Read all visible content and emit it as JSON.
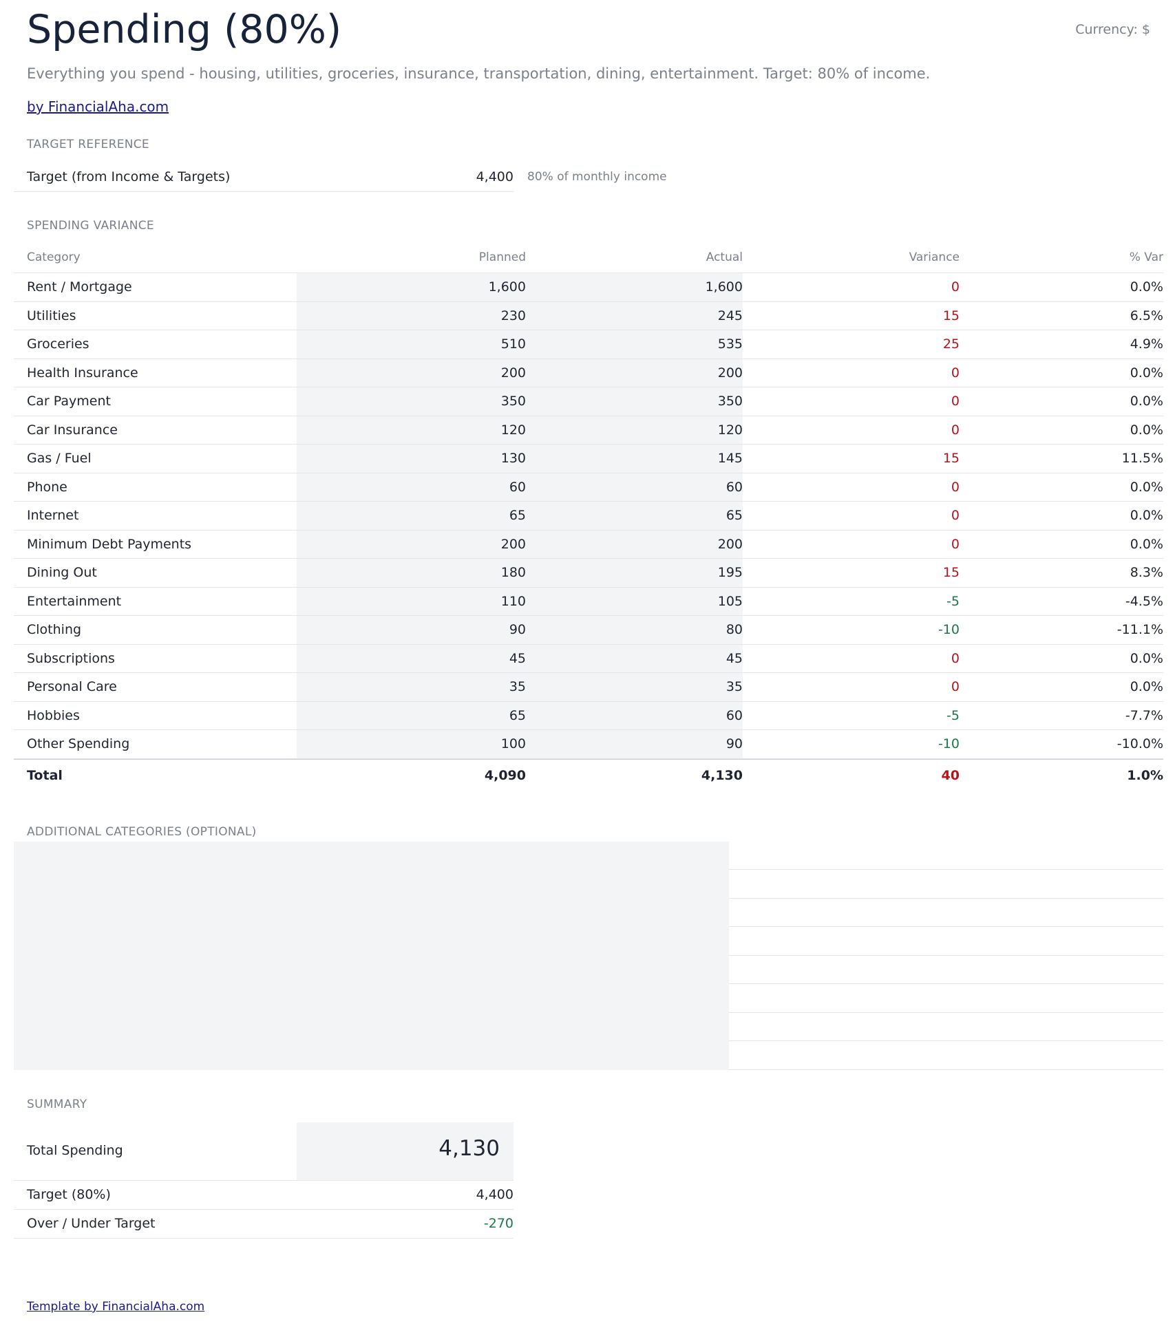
{
  "header": {
    "title": "Spending (80%)",
    "currency": "Currency: $",
    "subtitle": "Everything you spend - housing, utilities, groceries, insurance, transportation, dining, entertainment. Target: 80% of income.",
    "by_link": "by FinancialAha.com"
  },
  "target_reference": {
    "section_label": "TARGET REFERENCE",
    "label": "Target (from Income & Targets)",
    "value": "4,400",
    "note": "80% of monthly income"
  },
  "variance": {
    "section_label": "SPENDING VARIANCE",
    "columns": {
      "category": "Category",
      "planned": "Planned",
      "actual": "Actual",
      "variance": "Variance",
      "pct": "% Var"
    },
    "rows": [
      {
        "category": "Rent / Mortgage",
        "planned": "1,600",
        "actual": "1,600",
        "variance": "0",
        "pct": "0.0%",
        "sign": "pos"
      },
      {
        "category": "Utilities",
        "planned": "230",
        "actual": "245",
        "variance": "15",
        "pct": "6.5%",
        "sign": "pos"
      },
      {
        "category": "Groceries",
        "planned": "510",
        "actual": "535",
        "variance": "25",
        "pct": "4.9%",
        "sign": "pos"
      },
      {
        "category": "Health Insurance",
        "planned": "200",
        "actual": "200",
        "variance": "0",
        "pct": "0.0%",
        "sign": "pos"
      },
      {
        "category": "Car Payment",
        "planned": "350",
        "actual": "350",
        "variance": "0",
        "pct": "0.0%",
        "sign": "pos"
      },
      {
        "category": "Car Insurance",
        "planned": "120",
        "actual": "120",
        "variance": "0",
        "pct": "0.0%",
        "sign": "pos"
      },
      {
        "category": "Gas / Fuel",
        "planned": "130",
        "actual": "145",
        "variance": "15",
        "pct": "11.5%",
        "sign": "pos"
      },
      {
        "category": "Phone",
        "planned": "60",
        "actual": "60",
        "variance": "0",
        "pct": "0.0%",
        "sign": "pos"
      },
      {
        "category": "Internet",
        "planned": "65",
        "actual": "65",
        "variance": "0",
        "pct": "0.0%",
        "sign": "pos"
      },
      {
        "category": "Minimum Debt Payments",
        "planned": "200",
        "actual": "200",
        "variance": "0",
        "pct": "0.0%",
        "sign": "pos"
      },
      {
        "category": "Dining Out",
        "planned": "180",
        "actual": "195",
        "variance": "15",
        "pct": "8.3%",
        "sign": "pos"
      },
      {
        "category": "Entertainment",
        "planned": "110",
        "actual": "105",
        "variance": "-5",
        "pct": "-4.5%",
        "sign": "neg"
      },
      {
        "category": "Clothing",
        "planned": "90",
        "actual": "80",
        "variance": "-10",
        "pct": "-11.1%",
        "sign": "neg"
      },
      {
        "category": "Subscriptions",
        "planned": "45",
        "actual": "45",
        "variance": "0",
        "pct": "0.0%",
        "sign": "pos"
      },
      {
        "category": "Personal Care",
        "planned": "35",
        "actual": "35",
        "variance": "0",
        "pct": "0.0%",
        "sign": "pos"
      },
      {
        "category": "Hobbies",
        "planned": "65",
        "actual": "60",
        "variance": "-5",
        "pct": "-7.7%",
        "sign": "neg"
      },
      {
        "category": "Other Spending",
        "planned": "100",
        "actual": "90",
        "variance": "-10",
        "pct": "-10.0%",
        "sign": "neg"
      }
    ],
    "total": {
      "label": "Total",
      "planned": "4,090",
      "actual": "4,130",
      "variance": "40",
      "pct": "1.0%"
    }
  },
  "additional": {
    "section_label": "ADDITIONAL CATEGORIES (OPTIONAL)"
  },
  "summary": {
    "section_label": "SUMMARY",
    "total_spending_label": "Total Spending",
    "total_spending_value": "4,130",
    "target_label": "Target (80%)",
    "target_value": "4,400",
    "over_under_label": "Over / Under Target",
    "over_under_value": "-270"
  },
  "footer": {
    "link": "Template by FinancialAha.com"
  },
  "colors": {
    "positive_variance": "#b5141b",
    "negative_variance": "#177a48",
    "shade": "#f3f4f6",
    "link": "#1a1a8c"
  }
}
